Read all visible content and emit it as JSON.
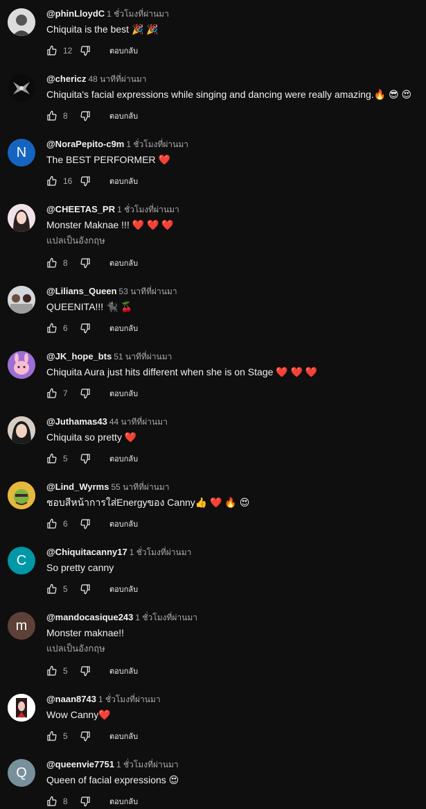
{
  "colors": {
    "background": "#0f0f0f",
    "text": "#f1f1f1",
    "muted": "#aaaaaa",
    "heart": "#e53935"
  },
  "icons": {
    "like": "thumb-up-icon",
    "dislike": "thumb-down-icon"
  },
  "comments": [
    {
      "author": "@phinLloydC",
      "time": "1 ชั่วโมงที่ผ่านมา",
      "text": "Chiquita is the best 🎉 🎉",
      "translate": "",
      "likes": "12",
      "reply": "ตอบกลับ",
      "avatar_letter": "",
      "avatar_color": "#d9d9d9"
    },
    {
      "author": "@chericz",
      "time": "48 นาทีที่ผ่านมา",
      "text": "Chiquita's facial expressions while singing and dancing were really amazing.🔥 😎 😍",
      "translate": "",
      "likes": "8",
      "reply": "ตอบกลับ",
      "avatar_letter": "",
      "avatar_color": "#111111"
    },
    {
      "author": "@NoraPepito-c9m",
      "time": "1 ชั่วโมงที่ผ่านมา",
      "text": "The BEST PERFORMER ❤️",
      "translate": "",
      "likes": "16",
      "reply": "ตอบกลับ",
      "avatar_letter": "N",
      "avatar_color": "#1565c0"
    },
    {
      "author": "@CHEETAS_PR",
      "time": "1 ชั่วโมงที่ผ่านมา",
      "text": "Monster Maknae !!! ❤️ ❤️ ❤️",
      "translate": "แปลเป็นอังกฤษ",
      "likes": "8",
      "reply": "ตอบกลับ",
      "avatar_letter": "",
      "avatar_color": "#f3e6ef"
    },
    {
      "author": "@Lilians_Queen",
      "time": "53 นาทีที่ผ่านมา",
      "text": "QUEENITA!!! 🐈‍⬛ 🍒",
      "translate": "",
      "likes": "6",
      "reply": "ตอบกลับ",
      "avatar_letter": "",
      "avatar_color": "#cfd3d6"
    },
    {
      "author": "@JK_hope_bts",
      "time": "51 นาทีที่ผ่านมา",
      "text": "Chiquita Aura just hits different when she is on Stage ❤️ ❤️ ❤️",
      "translate": "",
      "likes": "7",
      "reply": "ตอบกลับ",
      "avatar_letter": "",
      "avatar_color": "#8e63c7"
    },
    {
      "author": "@Juthamas43",
      "time": "44 นาทีที่ผ่านมา",
      "text": "Chiquita so pretty ❤️",
      "translate": "",
      "likes": "5",
      "reply": "ตอบกลับ",
      "avatar_letter": "",
      "avatar_color": "#cfc3b8"
    },
    {
      "author": "@Lind_Wyrms",
      "time": "55 นาทีที่ผ่านมา",
      "text": "ชอบสีหน้าการใส่Energyของ Canny👍 ❤️ 🔥 😍",
      "translate": "",
      "likes": "6",
      "reply": "ตอบกลับ",
      "avatar_letter": "",
      "avatar_color": "#e0b43a"
    },
    {
      "author": "@Chiquitacanny17",
      "time": "1 ชั่วโมงที่ผ่านมา",
      "text": "So pretty canny",
      "translate": "",
      "likes": "5",
      "reply": "ตอบกลับ",
      "avatar_letter": "C",
      "avatar_color": "#0097a7"
    },
    {
      "author": "@mandocasique243",
      "time": "1 ชั่วโมงที่ผ่านมา",
      "text": "Monster maknae!!",
      "translate": "แปลเป็นอังกฤษ",
      "likes": "5",
      "reply": "ตอบกลับ",
      "avatar_letter": "m",
      "avatar_color": "#5d4037"
    },
    {
      "author": "@naan8743",
      "time": "1 ชั่วโมงที่ผ่านมา",
      "text": "Wow Canny❤️",
      "translate": "",
      "likes": "5",
      "reply": "ตอบกลับ",
      "avatar_letter": "",
      "avatar_color": "#ffffff"
    },
    {
      "author": "@queenvie7751",
      "time": "1 ชั่วโมงที่ผ่านมา",
      "text": "Queen of facial expressions 😍",
      "translate": "",
      "likes": "8",
      "reply": "ตอบกลับ",
      "avatar_letter": "Q",
      "avatar_color": "#78909c"
    }
  ]
}
